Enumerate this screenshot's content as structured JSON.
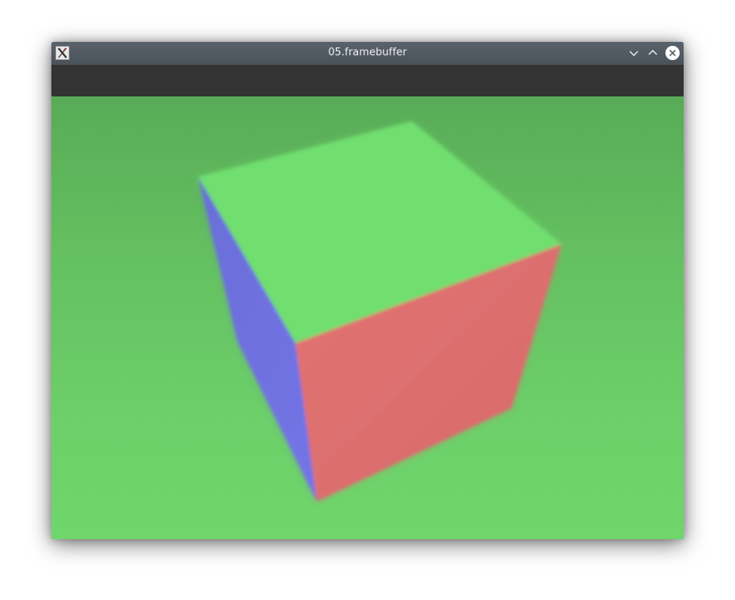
{
  "window": {
    "title": "05.framebuffer",
    "icon": "x11-app-icon",
    "controls": [
      "minimize-icon",
      "maximize-icon",
      "close-icon"
    ]
  },
  "scene": {
    "background_color": "#6ed66b",
    "cube_faces": {
      "top": "#71de70",
      "left": "#6f6fde",
      "front": "#df6f6f"
    }
  }
}
